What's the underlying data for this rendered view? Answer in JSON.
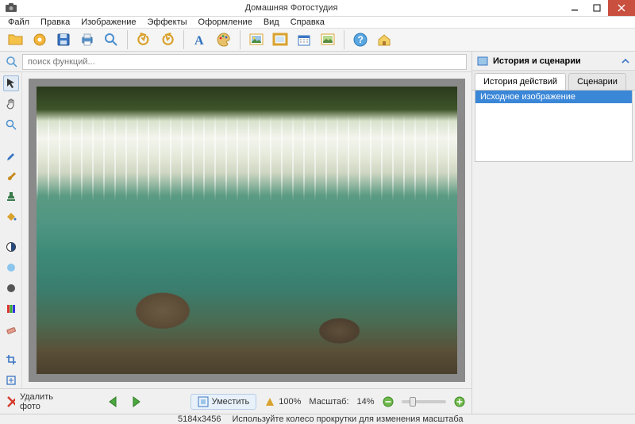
{
  "titlebar": {
    "title": "Домашняя Фотостудия"
  },
  "menu": {
    "file": "Файл",
    "edit": "Правка",
    "image": "Изображение",
    "effects": "Эффекты",
    "decor": "Оформление",
    "view": "Вид",
    "help": "Справка"
  },
  "search": {
    "placeholder": "поиск функций..."
  },
  "rightpanel": {
    "title": "История и сценарии",
    "tab_history": "История действий",
    "tab_scenarios": "Сценарии",
    "history_item": "Исходное изображение"
  },
  "bottom": {
    "delete": "Удалить фото",
    "fit": "Уместить",
    "pct100": "100%",
    "zoom_label": "Масштаб:",
    "zoom_value": "14%"
  },
  "status": {
    "dimensions": "5184x3456",
    "hint": "Используйте колесо прокрутки для изменения масштаба"
  },
  "colors": {
    "accent": "#3a87d8",
    "close": "#c94f3f"
  }
}
